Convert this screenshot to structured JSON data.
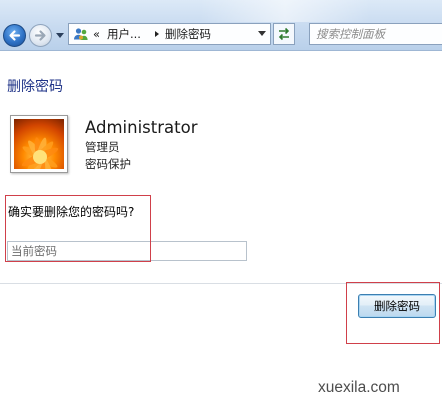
{
  "topbar": {
    "breadcrumb": {
      "prefix": "«",
      "segment_1": "用户...",
      "segment_2": "删除密码"
    },
    "search": {
      "placeholder": "搜索控制面板"
    },
    "icons": {
      "back": "back-arrow-icon",
      "forward": "forward-arrow-icon",
      "history": "chevron-down-icon",
      "location": "users-icon",
      "address_dropdown": "chevron-down-icon",
      "refresh": "refresh-icon"
    }
  },
  "content": {
    "page_title": "删除密码",
    "account": {
      "name": "Administrator",
      "type": "管理员",
      "status": "密码保护"
    },
    "confirm_question": "确实要删除您的密码吗?",
    "current_password": {
      "value": "",
      "placeholder": "当前密码"
    },
    "delete_button_label": "删除密码"
  },
  "annotation_color": "#d0404a",
  "watermark": "xuexila.com"
}
